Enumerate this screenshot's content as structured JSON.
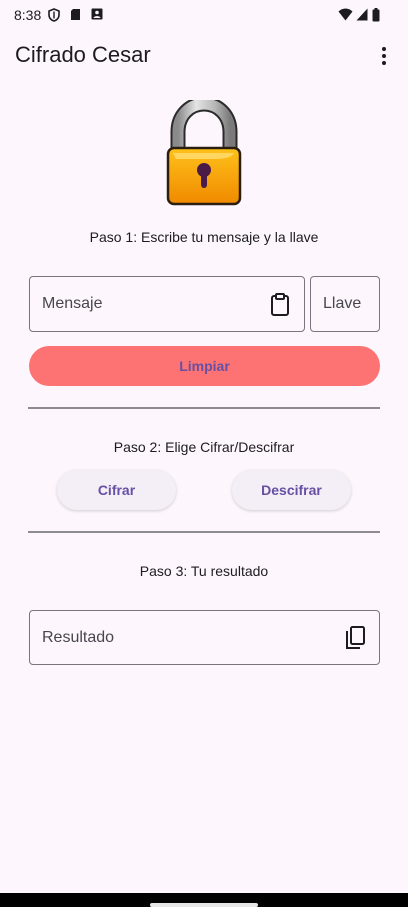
{
  "status_bar": {
    "time": "8:38"
  },
  "app_bar": {
    "title": "Cifrado Cesar"
  },
  "step1": {
    "text": "Paso 1: Escribe tu mensaje y la llave"
  },
  "inputs": {
    "message_label": "Mensaje",
    "key_label": "Llave"
  },
  "clear_button": {
    "label": "Limpiar"
  },
  "step2": {
    "text": "Paso 2: Elige Cifrar/Descifrar"
  },
  "actions": {
    "encrypt_label": "Cifrar",
    "decrypt_label": "Descifrar"
  },
  "step3": {
    "text": "Paso 3: Tu resultado"
  },
  "result": {
    "label": "Resultado"
  },
  "colors": {
    "background": "#fdf7fd",
    "clear_button": "#fd7272",
    "accent": "#6750a4",
    "lock_body": "#f7a10a"
  }
}
